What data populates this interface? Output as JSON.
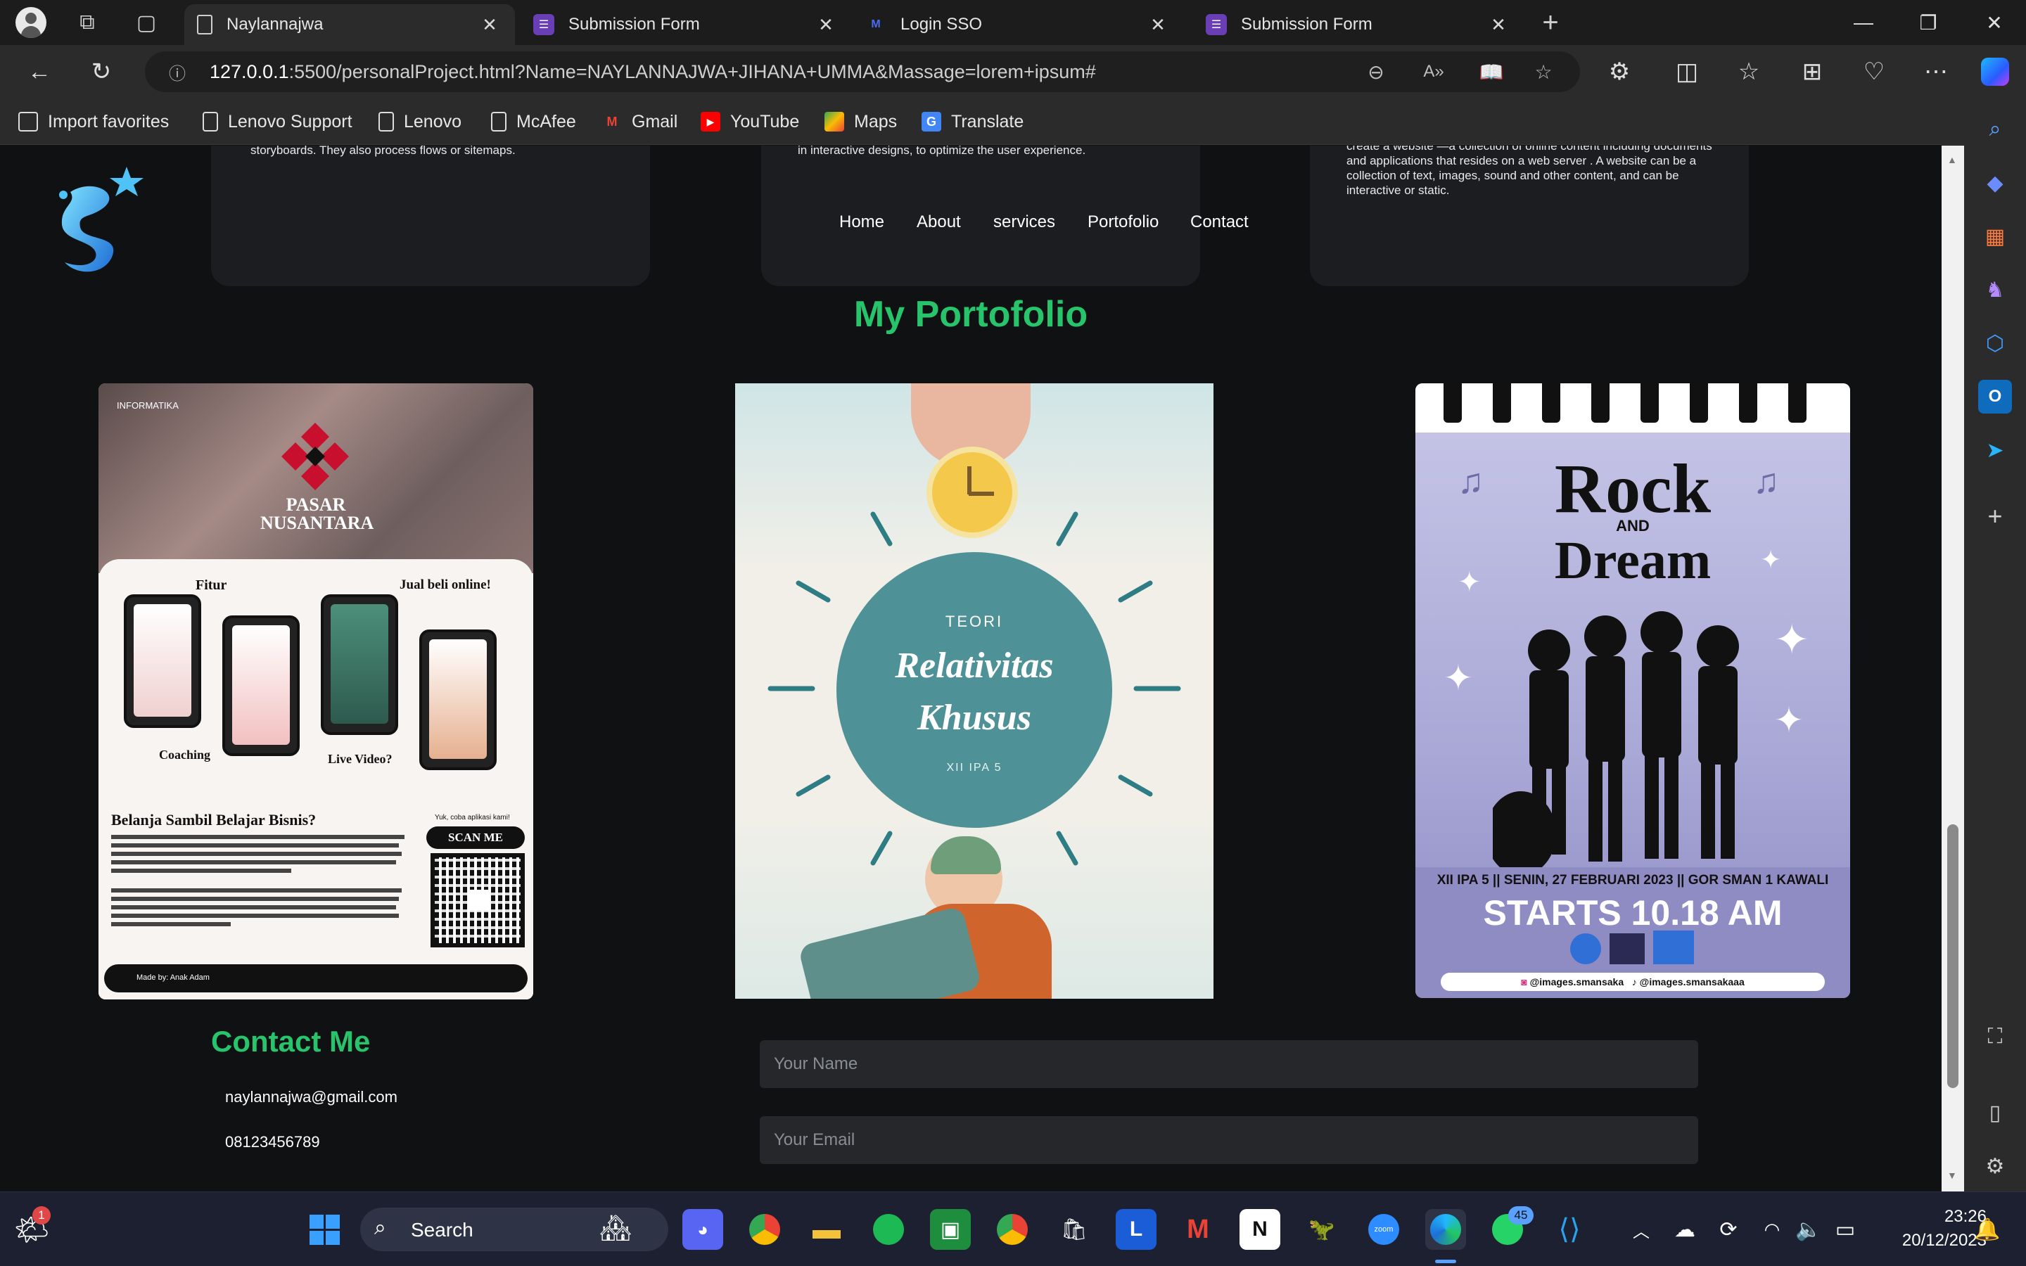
{
  "browser": {
    "tabs": [
      {
        "title": "Naylannajwa",
        "active": true
      },
      {
        "title": "Submission Form",
        "active": false
      },
      {
        "title": "Login SSO",
        "active": false
      },
      {
        "title": "Submission Form",
        "active": false
      }
    ],
    "url_host": "127.0.0.1",
    "url_rest": ":5500/personalProject.html?Name=NAYLANNAJWA+JIHANA+UMMA&Massage=lorem+ipsum#",
    "favorites": [
      "Import favorites",
      "Lenovo Support",
      "Lenovo",
      "McAfee",
      "Gmail",
      "YouTube",
      "Maps",
      "Translate"
    ]
  },
  "page": {
    "cards": [
      {
        "text": "storyboards. They also process flows or sitemaps."
      },
      {
        "text": "in interactive designs, to optimize the user experience."
      },
      {
        "text": "create a website —a collection of online content including documents and applications that resides on a web server . A website can be a collection of text, images, sound and other content, and can be interactive or static."
      }
    ],
    "nav": [
      "Home",
      "About",
      "services",
      "Portofolio",
      "Contact"
    ],
    "portfolio_title": "My Portofolio",
    "portfolio": [
      {
        "top_label": "INFORMATIKA",
        "brand": "PASAR NUSANTARA",
        "fitur": "Fitur",
        "jual": "Jual beli online!",
        "coaching": "Coaching",
        "live": "Live Video?",
        "heading": "Belanja Sambil Belajar Bisnis?",
        "scan": "SCAN ME",
        "yuk": "Yuk, coba aplikasi kami!",
        "made_by": "Made by: Anak Adam"
      },
      {
        "teori": "TEORI",
        "title1": "Relativitas",
        "title2": "Khusus",
        "class": "XII IPA 5"
      },
      {
        "title1": "Rock",
        "and": "AND",
        "title2": "Dream",
        "info": "XII IPA 5 || SENIN, 27 FEBRUARI 2023 || GOR SMAN 1 KAWALI",
        "starts": "STARTS 10.18 AM",
        "ig": "@images.smansaka",
        "tt": "@images.smansakaaa"
      }
    ],
    "contact": {
      "title": "Contact Me",
      "email": "naylannajwa@gmail.com",
      "phone": "08123456789",
      "name_placeholder": "Your Name",
      "email_placeholder": "Your Email"
    }
  },
  "taskbar": {
    "search": "Search",
    "time": "23:26",
    "date": "20/12/2023",
    "whatsapp_badge": "45",
    "weather_badge": "1"
  },
  "colors": {
    "accent_green": "#27c46b",
    "background": "#0f1113",
    "teal": "#4e9297",
    "lavender": "#a9a8d6"
  }
}
